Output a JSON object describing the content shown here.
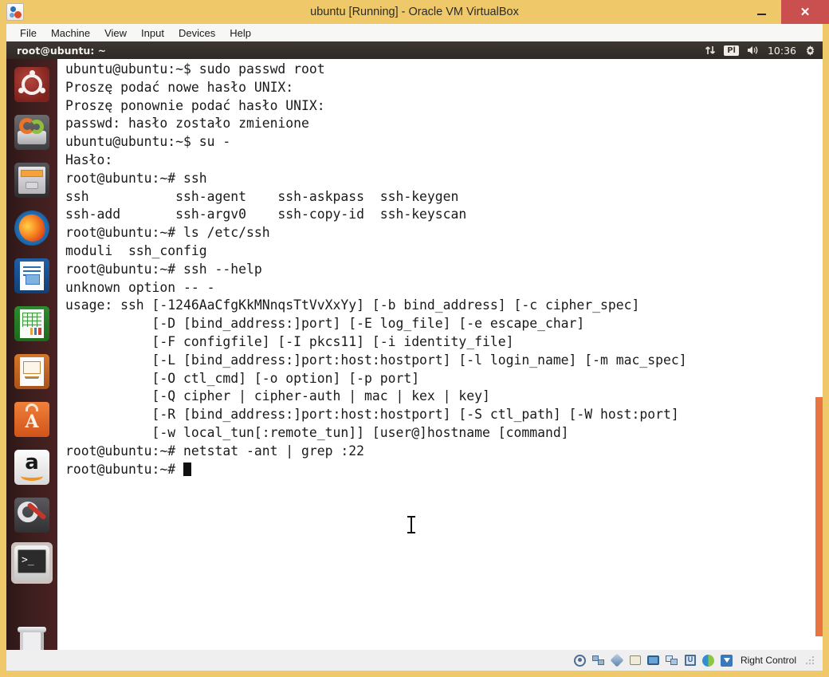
{
  "host_window": {
    "title": "ubuntu [Running] - Oracle VM VirtualBox",
    "logo_name": "virtualbox-logo",
    "controls": {
      "minimize": "–",
      "maximize": "□",
      "close": "✕"
    },
    "menu": [
      "File",
      "Machine",
      "View",
      "Input",
      "Devices",
      "Help"
    ]
  },
  "guest": {
    "panel": {
      "title": "root@ubuntu: ~",
      "keyboard_layout": "Pl",
      "clock": "10:36",
      "icons": [
        "network-icon",
        "keyboard-layout-icon",
        "volume-icon",
        "clock",
        "gear-icon"
      ]
    },
    "launcher": {
      "items": [
        {
          "name": "dash-home",
          "label": "Ubuntu Dash",
          "icon": "ubuntu-icon",
          "active": false
        },
        {
          "name": "backups",
          "label": "Déjà Dup Backups",
          "icon": "backup-icon",
          "active": false
        },
        {
          "name": "files",
          "label": "Files",
          "icon": "file-manager-icon",
          "active": false
        },
        {
          "name": "firefox",
          "label": "Firefox Web Browser",
          "icon": "firefox-icon",
          "active": false
        },
        {
          "name": "libreoffice-writer",
          "label": "LibreOffice Writer",
          "icon": "writer-icon",
          "active": false
        },
        {
          "name": "libreoffice-calc",
          "label": "LibreOffice Calc",
          "icon": "calc-icon",
          "active": false
        },
        {
          "name": "libreoffice-impress",
          "label": "LibreOffice Impress",
          "icon": "impress-icon",
          "active": false
        },
        {
          "name": "software-center",
          "label": "Ubuntu Software Center",
          "icon": "software-center-icon",
          "active": false
        },
        {
          "name": "amazon",
          "label": "Amazon",
          "icon": "amazon-icon",
          "active": false
        },
        {
          "name": "system-settings",
          "label": "System Settings",
          "icon": "settings-icon",
          "active": false
        },
        {
          "name": "terminal",
          "label": "Terminal",
          "icon": "terminal-icon",
          "active": true
        },
        {
          "name": "trash",
          "label": "Trash",
          "icon": "trash-icon",
          "active": false
        }
      ]
    },
    "terminal": {
      "lines": [
        "ubuntu@ubuntu:~$ sudo passwd root",
        "Proszę podać nowe hasło UNIX:",
        "Proszę ponownie podać hasło UNIX:",
        "passwd: hasło zostało zmienione",
        "ubuntu@ubuntu:~$ su -",
        "Hasło:",
        "root@ubuntu:~# ssh",
        "ssh           ssh-agent    ssh-askpass  ssh-keygen",
        "ssh-add       ssh-argv0    ssh-copy-id  ssh-keyscan",
        "root@ubuntu:~# ls /etc/ssh",
        "moduli  ssh_config",
        "root@ubuntu:~# ssh --help",
        "unknown option -- -",
        "usage: ssh [-1246AaCfgKkMNnqsTtVvXxYy] [-b bind_address] [-c cipher_spec]",
        "           [-D [bind_address:]port] [-E log_file] [-e escape_char]",
        "           [-F configfile] [-I pkcs11] [-i identity_file]",
        "           [-L [bind_address:]port:host:hostport] [-l login_name] [-m mac_spec]",
        "           [-O ctl_cmd] [-o option] [-p port]",
        "           [-Q cipher | cipher-auth | mac | kex | key]",
        "           [-R [bind_address:]port:host:hostport] [-S ctl_path] [-W host:port]",
        "           [-w local_tun[:remote_tun]] [user@]hostname [command]",
        "root@ubuntu:~# netstat -ant | grep :22"
      ],
      "prompt": "root@ubuntu:~# ",
      "cursor": "block"
    }
  },
  "statusbar": {
    "icons": [
      "optical-drive-icon",
      "network-adapter-icon",
      "usb-icon",
      "shared-folders-icon",
      "display-icon",
      "remote-desktop-icon",
      "cpu-icon",
      "mouse-integration-icon",
      "host-key-icon"
    ],
    "host_key": "Right Control"
  },
  "colors": {
    "vbox_chrome": "#efc969",
    "close_button": "#c9504f",
    "unity_panel": "#3c3732",
    "launcher": "#3b1d1d",
    "terminal_bg": "#ffffff",
    "terminal_fg": "#1a1a1a",
    "scrollbar_thumb": "#e8743f",
    "statusbar": "#efefef"
  }
}
